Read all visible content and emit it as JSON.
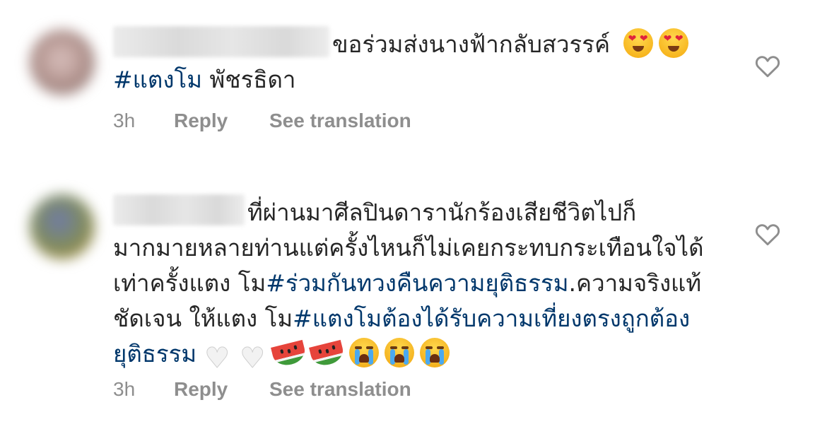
{
  "comments": [
    {
      "text_before": "ขอร่วมส่งนางฟ้ากลับสวรรค์",
      "hashtag": "#แตงโม",
      "text_after": " พัชรธิดา",
      "timestamp": "3h",
      "reply_label": "Reply",
      "translate_label": "See translation",
      "emojis": [
        "smiling-face-with-heart-eyes",
        "smiling-face-with-heart-eyes"
      ]
    },
    {
      "text_part1": "ที่ผ่านมาศีลปินดารานักร้องเสียชีวิตไปก็มากมายหลายท่านแต่ครั้งไหนก็ไม่เคยกระทบกระเทือนใจได้เท่าครั้งแตง โม",
      "hashtag1": "#ร่วมกันทวงคืนความยุติธรรม",
      "text_part2": ".ความจริงแท้ชัดเจน ให้แตง โม",
      "hashtag2": "#แตงโมต้องได้รับความเที่ยงตรงถูกต้องยุติธรรม",
      "timestamp": "3h",
      "reply_label": "Reply",
      "translate_label": "See translation",
      "emojis": [
        "white-heart",
        "white-heart",
        "watermelon",
        "watermelon",
        "loudly-crying-face",
        "loudly-crying-face",
        "loudly-crying-face"
      ]
    }
  ],
  "colors": {
    "text": "#262626",
    "hashtag": "#00376b",
    "meta": "#8e8e8e",
    "background": "#ffffff"
  },
  "icons": {
    "like": "heart-outline-icon"
  }
}
